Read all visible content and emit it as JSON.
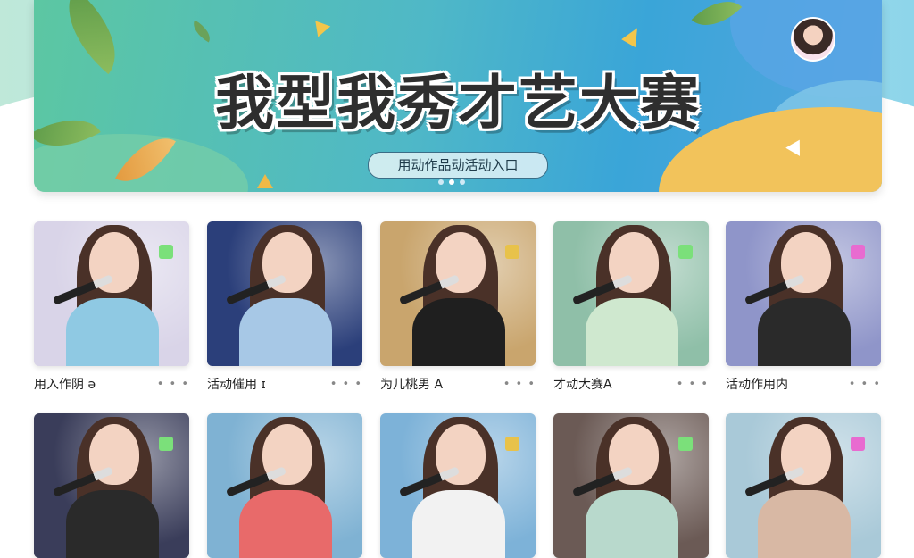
{
  "banner": {
    "title": "我型我秀才艺大赛",
    "pill_text": "用动作品动活动入口",
    "carousel_dots": 3,
    "carousel_active": 1
  },
  "icons": {
    "more": "more-dots-icon",
    "note": "music-note-icon"
  },
  "cards_row1": [
    {
      "label": "用入作阴 ə",
      "bg": "#d9d4e8",
      "outfit": "#8fc9e3"
    },
    {
      "label": "活动催用 ɪ",
      "bg": "#2b3f7a",
      "outfit": "#a7c8e6"
    },
    {
      "label": "为儿桃男 A",
      "bg": "#c9a56d",
      "outfit": "#1f1f1f"
    },
    {
      "label": "才动大赛A",
      "bg": "#8fbfa8",
      "outfit": "#cfe8cf"
    },
    {
      "label": "活动作用内",
      "bg": "#8f95c9",
      "outfit": "#2a2a2a"
    }
  ],
  "cards_row2": [
    {
      "bg": "#3a3d5a",
      "outfit": "#2a2a2a"
    },
    {
      "bg": "#7fb2d3",
      "outfit": "#e86a6a"
    },
    {
      "bg": "#7db2d8",
      "outfit": "#f2f2f2"
    },
    {
      "bg": "#6b5a55",
      "outfit": "#b8d9cc"
    },
    {
      "bg": "#a9c9d8",
      "outfit": "#d8b8a4"
    }
  ],
  "more_text": "• • •"
}
